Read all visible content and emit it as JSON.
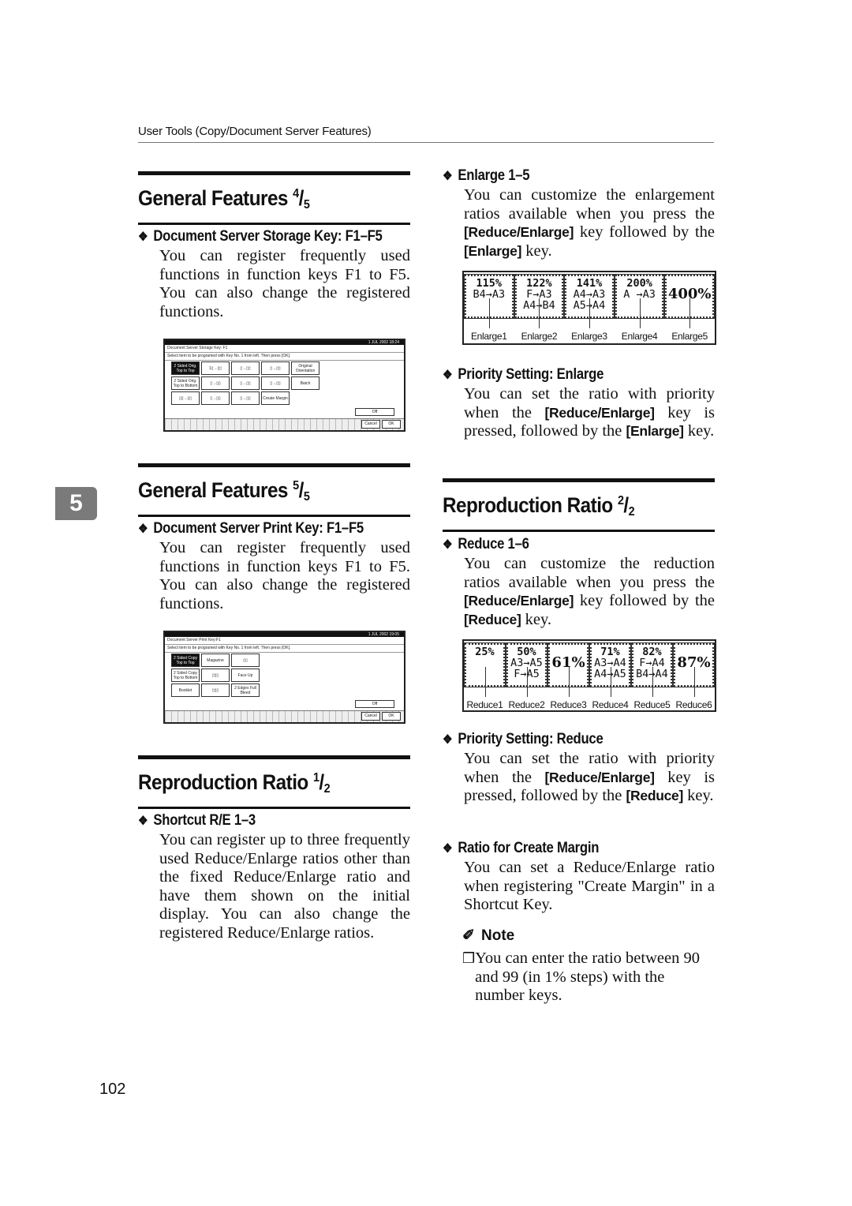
{
  "running_head": "User Tools (Copy/Document Server Features)",
  "chapter_tab": "5",
  "page_number": "102",
  "left_column": {
    "section1": {
      "title": "General Features",
      "fraction_num": "4",
      "fraction_den": "5",
      "item": {
        "heading": "Document Server Storage Key: F1–F5",
        "body": "You can register frequently used functions in function keys F1 to F5. You can also change the registered functions."
      },
      "screen": {
        "date": "1 JUL  2002 18:24",
        "title": "Document Server Storage Key: F1",
        "instruction": "Select item to be programed with Key No. 1 from left. Then press [OK].",
        "buttons": [
          "2 Sided Orig. Top to Top",
          "1▯→▯▯",
          "▯→▯▯",
          "▯→▯▯",
          "Original Orientation",
          "2 Sided Orig. Top to Bottom",
          "▯→▯▯",
          "▯→▯▯",
          "▯→▯▯",
          "Batch",
          "▯▯→▯▯",
          "▯→▯▯",
          "▯→▯▯",
          "Create Margin"
        ],
        "off_label": "Off",
        "cancel_label": "Cancel",
        "ok_label": "OK"
      }
    },
    "section2": {
      "title": "General Features",
      "fraction_num": "5",
      "fraction_den": "5",
      "item": {
        "heading": "Document Server Print Key: F1–F5",
        "body": "You can register frequently used functions in function keys F1 to F5. You can also change the registered functions."
      },
      "screen": {
        "date": "1 JUL  2002 19:05",
        "title": "Document Server Print Key:F1",
        "instruction": "Select item to be programed with Key No. 1 from left. Then press [OK].",
        "buttons": [
          "2 Sided Copy Top to Top",
          "Magazine",
          "▯▯",
          "2 Sided Copy Top to Bottom",
          "▯▯▯",
          "Face Up",
          "Booklet",
          "▯▯▯",
          "2 Edges Full Bleed"
        ],
        "off_label": "Off",
        "cancel_label": "Cancel",
        "ok_label": "OK"
      }
    },
    "section3": {
      "title": "Reproduction Ratio",
      "fraction_num": "1",
      "fraction_den": "2",
      "item": {
        "heading": "Shortcut R/E 1–3",
        "body": "You can register up to three frequently used Reduce/Enlarge ratios other than the fixed Reduce/Enlarge ratio and have them shown on the initial display. You can also change the registered Reduce/Enlarge ratios."
      }
    }
  },
  "right_column": {
    "enlarge": {
      "heading": "Enlarge 1–5",
      "body_pre": "You can customize the enlargement ratios available when you press the ",
      "key1": "[Reduce/Enlarge]",
      "body_mid": " key followed by the ",
      "key2": "[Enlarge]",
      "body_post": " key.",
      "panel": [
        {
          "pct": "115%",
          "lines": [
            "B4→A3"
          ],
          "label": "Enlarge1"
        },
        {
          "pct": "122%",
          "lines": [
            "F→A3",
            "A4→B4"
          ],
          "label": "Enlarge2"
        },
        {
          "pct": "141%",
          "lines": [
            "A4→A3",
            "A5→A4"
          ],
          "label": "Enlarge3"
        },
        {
          "pct": "200%",
          "lines": [
            "A →A3"
          ],
          "label": "Enlarge4"
        },
        {
          "pct": "400%",
          "lines": [],
          "label": "Enlarge5",
          "big": true
        }
      ]
    },
    "priority_enlarge": {
      "heading": "Priority Setting: Enlarge",
      "body_pre": "You can set the ratio with priority when the ",
      "key1": "[Reduce/Enlarge]",
      "body_mid": " key is pressed, followed by the ",
      "key2": "[Enlarge]",
      "body_post": " key."
    },
    "section4": {
      "title": "Reproduction Ratio",
      "fraction_num": "2",
      "fraction_den": "2"
    },
    "reduce": {
      "heading": "Reduce 1–6",
      "body_pre": "You can customize the reduction ratios available when you press the ",
      "key1": "[Reduce/Enlarge]",
      "body_mid": " key followed by the ",
      "key2": "[Reduce]",
      "body_post": " key.",
      "panel": [
        {
          "pct": "25%",
          "lines": [],
          "label": "Reduce1"
        },
        {
          "pct": "50%",
          "lines": [
            "A3→A5",
            "F→A5"
          ],
          "label": "Reduce2"
        },
        {
          "pct": "61%",
          "lines": [],
          "label": "Reduce3",
          "big": true
        },
        {
          "pct": "71%",
          "lines": [
            "A3→A4",
            "A4→A5"
          ],
          "label": "Reduce4"
        },
        {
          "pct": "82%",
          "lines": [
            "F→A4",
            "B4→A4"
          ],
          "label": "Reduce5"
        },
        {
          "pct": "87%",
          "lines": [],
          "label": "Reduce6",
          "big": true
        }
      ]
    },
    "priority_reduce": {
      "heading": "Priority Setting: Reduce",
      "body_pre": "You can set the ratio with priority when the ",
      "key1": "[Reduce/Enlarge]",
      "body_mid": " key is pressed, followed by the ",
      "key2": "[Reduce]",
      "body_post": " key."
    },
    "create_margin": {
      "heading": "Ratio for Create Margin",
      "body": "You can set a Reduce/Enlarge ratio when registering \"Create Margin\" in a Shortcut Key."
    },
    "note": {
      "label": "Note",
      "items": [
        "You can enter the ratio between 90 and 99 (in 1% steps) with the number keys."
      ]
    }
  }
}
